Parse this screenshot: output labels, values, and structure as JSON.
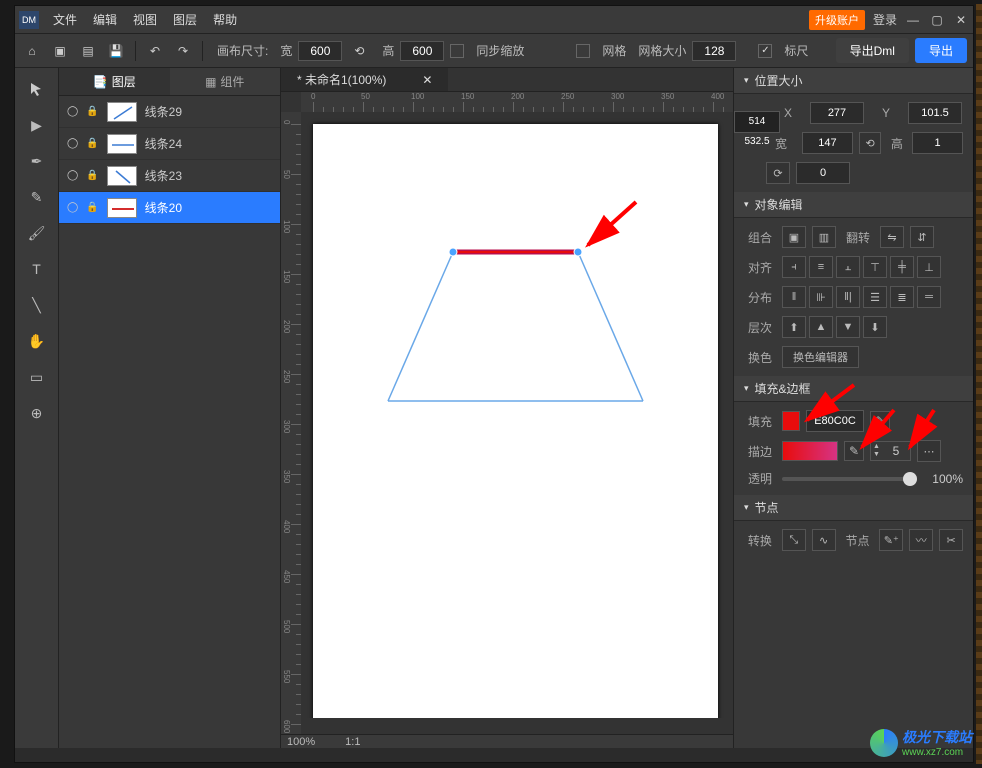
{
  "menu": {
    "file": "文件",
    "edit": "编辑",
    "view": "视图",
    "layer": "图层",
    "help": "帮助"
  },
  "title_right": {
    "upgrade": "升级账户",
    "login": "登录"
  },
  "toolbar": {
    "canvas_size_lbl": "画布尺寸:",
    "w_lbl": "宽",
    "w_val": "600",
    "h_lbl": "高",
    "h_val": "600",
    "sync_zoom": "同步缩放",
    "grid_lbl": "网格",
    "grid_size_lbl": "网格大小",
    "grid_size_val": "128",
    "ruler_lbl": "标尺",
    "export_dml": "导出Dml",
    "export": "导出"
  },
  "side_tabs": {
    "layers": "图层",
    "components": "组件"
  },
  "layers": [
    {
      "name": "线条29",
      "thumb_color": "#3b7bd4",
      "thumb_kind": "diag"
    },
    {
      "name": "线条24",
      "thumb_color": "#3b7bd4",
      "thumb_kind": "hline"
    },
    {
      "name": "线条23",
      "thumb_color": "#3b7bd4",
      "thumb_kind": "diag2"
    },
    {
      "name": "线条20",
      "thumb_color": "#d42c2c",
      "thumb_kind": "hline"
    }
  ],
  "doc_tab": "* 未命名1(100%)",
  "status": {
    "zoom": "100%",
    "ratio": "1:1"
  },
  "pos_size": {
    "title": "位置大小",
    "x_lbl": "X",
    "x_tip": "514 532.5",
    "x_val": "277",
    "y_lbl": "Y",
    "y_val": "101.5",
    "w_lbl": "宽",
    "w_val": "147",
    "h_lbl": "高",
    "h_val": "1",
    "rot_val": "0"
  },
  "obj_edit": {
    "title": "对象编辑",
    "group_lbl": "组合",
    "flip_lbl": "翻转",
    "align_lbl": "对齐",
    "distribute_lbl": "分布",
    "zorder_lbl": "层次",
    "swap_lbl": "换色",
    "swap_btn": "换色编辑器"
  },
  "fill_stroke": {
    "title": "填充&边框",
    "fill_lbl": "填充",
    "fill_color": "#E80C0C",
    "fill_hex": "E80C0C",
    "stroke_lbl": "描边",
    "stroke_color_from": "#e80c0c",
    "stroke_color_to": "#d63384",
    "stroke_width": "5",
    "opacity_lbl": "透明",
    "opacity_val": "100%"
  },
  "nodes": {
    "title": "节点",
    "convert_lbl": "转换",
    "nodes_lbl": "节点"
  },
  "watermark": {
    "text": "极光下载站",
    "url": "www.xz7.com"
  }
}
